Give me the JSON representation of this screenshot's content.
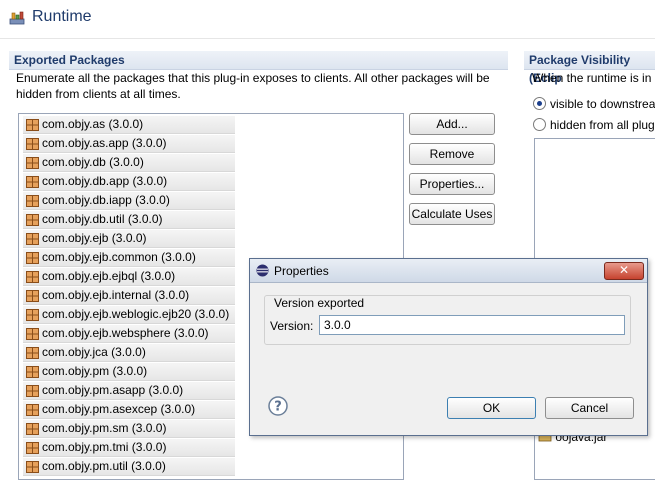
{
  "page": {
    "title": "Runtime"
  },
  "exported_packages": {
    "heading": "Exported Packages",
    "description_line1": "Enumerate all the packages that this plug-in exposes to clients.  All other packages will be",
    "description_line2": "hidden from clients at all times.",
    "items": [
      "com.objy.as (3.0.0)",
      "com.objy.as.app (3.0.0)",
      "com.objy.db (3.0.0)",
      "com.objy.db.app (3.0.0)",
      "com.objy.db.iapp (3.0.0)",
      "com.objy.db.util (3.0.0)",
      "com.objy.ejb (3.0.0)",
      "com.objy.ejb.common (3.0.0)",
      "com.objy.ejb.ejbql (3.0.0)",
      "com.objy.ejb.internal (3.0.0)",
      "com.objy.ejb.weblogic.ejb20 (3.0.0)",
      "com.objy.ejb.websphere (3.0.0)",
      "com.objy.jca (3.0.0)",
      "com.objy.pm (3.0.0)",
      "com.objy.pm.asapp (3.0.0)",
      "com.objy.pm.asexcep (3.0.0)",
      "com.objy.pm.sm (3.0.0)",
      "com.objy.pm.tmi (3.0.0)",
      "com.objy.pm.util (3.0.0)"
    ],
    "buttons": {
      "add": "Add...",
      "remove": "Remove",
      "properties": "Properties...",
      "calculate_uses": "Calculate Uses"
    }
  },
  "package_visibility": {
    "heading": "Package Visibility (Eclip",
    "description": "When the runtime is in",
    "option_visible": "visible to downstrean",
    "option_hidden": "hidden from all plug",
    "jar_label": "oojava.jar"
  },
  "dialog": {
    "title": "Properties",
    "group_label": "Version exported",
    "version_label": "Version:",
    "version_value": "3.0.0",
    "ok": "OK",
    "cancel": "Cancel",
    "close_glyph": "✕"
  }
}
